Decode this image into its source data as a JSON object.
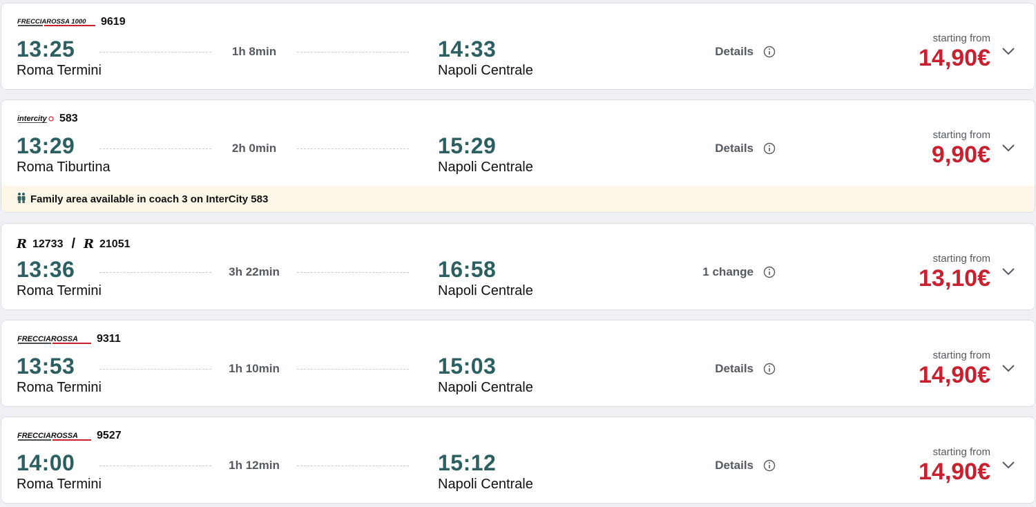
{
  "colors": {
    "time": "#2c5f5f",
    "price": "#c8202e",
    "notice_bg": "#fcf6e8",
    "frecciarossa_red": "#c8202e"
  },
  "solutions": [
    {
      "brand": "FRECCIAROSSA 1000",
      "train_numbers": [
        "9619"
      ],
      "departure_time": "13:25",
      "departure_station": "Roma Termini",
      "duration": "1h 8min",
      "arrival_time": "14:33",
      "arrival_station": "Napoli Centrale",
      "info_label": "Details",
      "price_caption": "starting from",
      "price": "14,90€"
    },
    {
      "brand": "intercity",
      "train_numbers": [
        "583"
      ],
      "departure_time": "13:29",
      "departure_station": "Roma Tiburtina",
      "duration": "2h 0min",
      "arrival_time": "15:29",
      "arrival_station": "Napoli Centrale",
      "info_label": "Details",
      "price_caption": "starting from",
      "price": "9,90€",
      "notice": "Family area available in coach 3 on InterCity 583",
      "notice_icon": "family-icon"
    },
    {
      "brand": "R",
      "train_numbers": [
        "12733",
        "21051"
      ],
      "separator": "/",
      "departure_time": "13:36",
      "departure_station": "Roma Termini",
      "duration": "3h 22min",
      "arrival_time": "16:58",
      "arrival_station": "Napoli Centrale",
      "info_label": "1 change",
      "price_caption": "starting from",
      "price": "13,10€"
    },
    {
      "brand": "FRECCIAROSSA",
      "train_numbers": [
        "9311"
      ],
      "departure_time": "13:53",
      "departure_station": "Roma Termini",
      "duration": "1h 10min",
      "arrival_time": "15:03",
      "arrival_station": "Napoli Centrale",
      "info_label": "Details",
      "price_caption": "starting from",
      "price": "14,90€"
    },
    {
      "brand": "FRECCIAROSSA",
      "train_numbers": [
        "9527"
      ],
      "departure_time": "14:00",
      "departure_station": "Roma Termini",
      "duration": "1h 12min",
      "arrival_time": "15:12",
      "arrival_station": "Napoli Centrale",
      "info_label": "Details",
      "price_caption": "starting from",
      "price": "14,90€"
    }
  ]
}
